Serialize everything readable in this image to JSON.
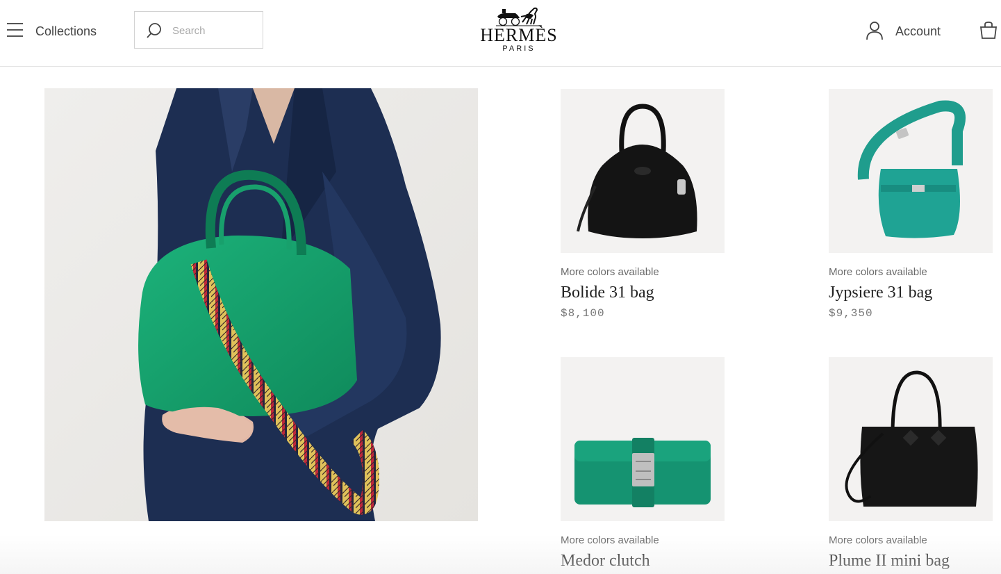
{
  "header": {
    "menu_icon": "hamburger-icon",
    "collections_label": "Collections",
    "search_placeholder": "Search",
    "search_icon": "search-icon",
    "brand_name": "HERMÈS",
    "brand_city": "PARIS",
    "account_label": "Account",
    "account_icon": "user-icon",
    "cart_icon": "shopping-bag-icon"
  },
  "products": [
    {
      "colors_note": "More colors available",
      "name": "Bolide 31 bag",
      "price": "$8,100",
      "color": "#121212"
    },
    {
      "colors_note": "More colors available",
      "name": "Jypsiere 31 bag",
      "price": "$9,350",
      "color": "#1fa394"
    },
    {
      "colors_note": "More colors available",
      "name": "Medor clutch",
      "price": "",
      "color": "#159371"
    },
    {
      "colors_note": "More colors available",
      "name": "Plume II mini bag",
      "price": "",
      "color": "#161616"
    }
  ],
  "colors": {
    "accent_green": "#16a36c",
    "jacket_navy": "#1d2e52"
  }
}
